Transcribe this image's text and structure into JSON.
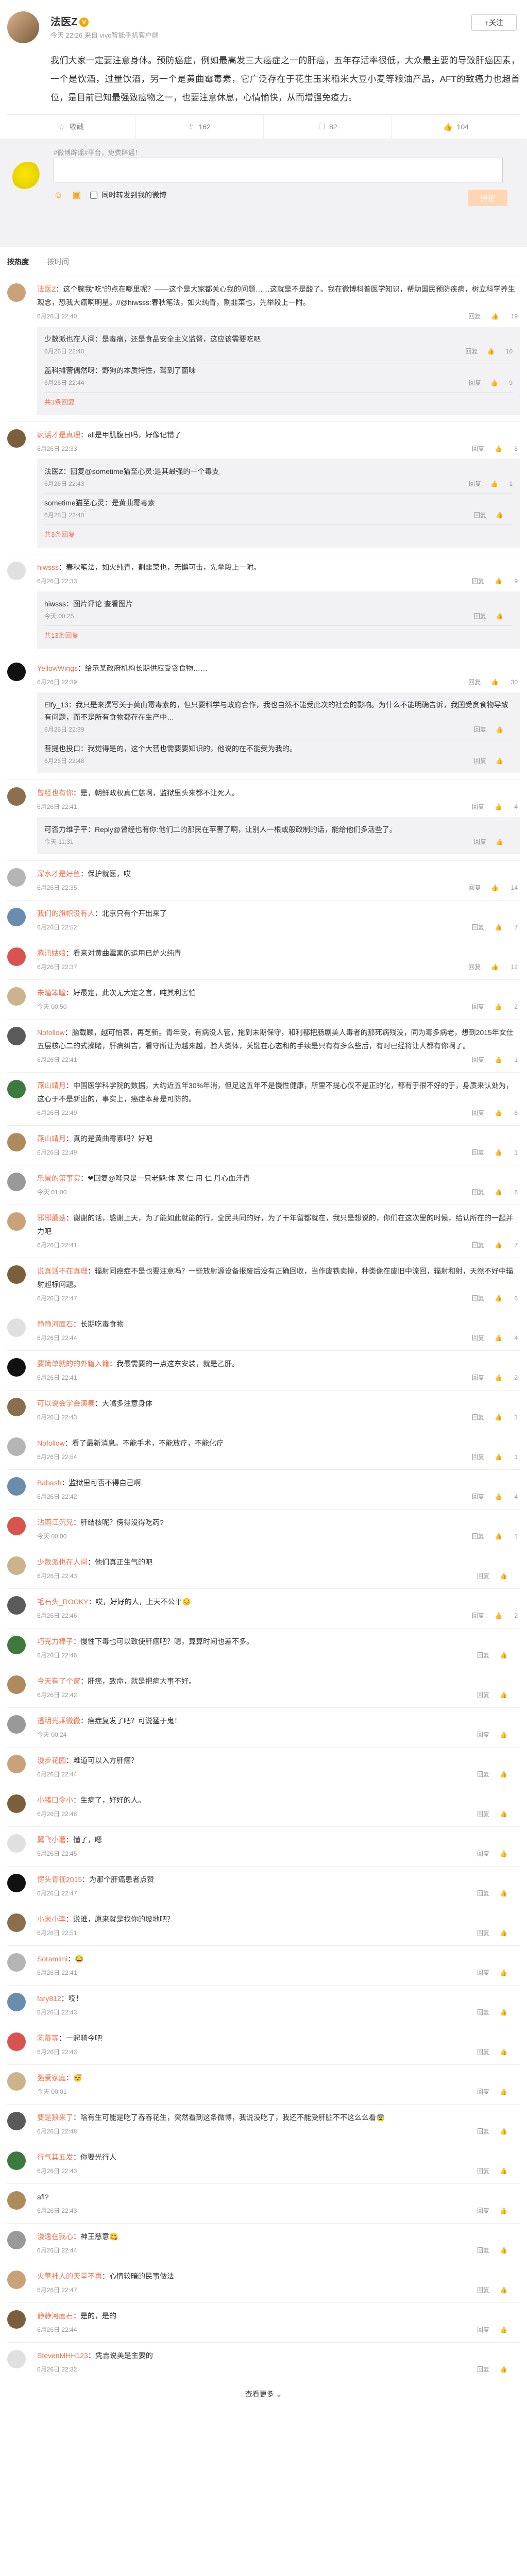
{
  "post": {
    "author": "法医Z",
    "vip_badge": "V",
    "meta": "今天 22:26 来自 vivo智能手机客户端",
    "follow_label": "+关注",
    "body": "我们大家一定要注意身体。预防癌症，例如最高发三大癌症之一的肝癌，五年存活率很低，大众最主要的导致肝癌因素，一个是饮酒，过量饮酒，另一个是黄曲霉毒素，它广泛存在于花生玉米稻米大豆小麦等粮油产品，AFT的致癌力也超首位，是目前已知最强致癌物之一，也要注意休息，心情愉快，从而增强免疫力。",
    "actions": [
      {
        "icon": "☆",
        "label": "收藏"
      },
      {
        "icon": "⇪",
        "label": "162"
      },
      {
        "icon": "☐",
        "label": "82"
      },
      {
        "icon": "👍",
        "label": "104"
      }
    ]
  },
  "composer": {
    "tag_line": "#微博辟谣#平台，免费辟谣！",
    "placeholder": "",
    "checkbox_label": "同时转发到我的微博",
    "submit_label": "评论"
  },
  "tabs": {
    "hot": "按热度",
    "time": "按时间"
  },
  "comments": [
    {
      "name": "法医Z",
      "text": "：这个腕我“吃”的点在哪里呢？——这个是大家都关心我的问题……这就是不是酸了。我在微博科普医学知识，帮助国民预防疾病，树立科学养生观念，恐我大癌啊明星。//@hiwsss:春秋笔法，如火纯青，割韭菜也，先举段上一附。",
      "time": "6月26日 22:40",
      "likes": "19",
      "replies": [
        {
          "text": "少数派也在人间：是毒瘤，还是食品安全主义监督，这应该需要吃吧",
          "time": "6月26日 22:40",
          "likes": "10"
        },
        {
          "text": "盖科摊营偶然呀：野狗的本质特性，驾到了面味",
          "time": "6月26日 22:44",
          "likes": "9"
        }
      ],
      "more": "共3条回复"
    },
    {
      "name": "疯话才是真理",
      "text": "：ali是甲肌腹日吗，好像记错了",
      "time": "6月26日 22:33",
      "likes": "6",
      "replies": [
        {
          "text": "法医Z：回复@sometime猫至心灵:是其最强的一个毒支",
          "time": "6月26日 22:43",
          "likes": "1"
        },
        {
          "text": "sometime猫至心灵：是黄曲霉毒素",
          "time": "6月26日 22:40",
          "likes": ""
        }
      ],
      "more": "共3条回复"
    },
    {
      "name": "hiwsss",
      "text": "：春秋笔法，如火纯青，割韭菜也，无懈可击，先举段上一附。",
      "time": "6月26日 22:33",
      "likes": "9",
      "replies": [
        {
          "text": "hiwsss：图片评论 查看图片",
          "time": "今天 00:25",
          "likes": ""
        }
      ],
      "more": "共13条回复"
    },
    {
      "name": "YellowWings",
      "text": "：给示某政府机构长期供应受贪食物……",
      "time": "6月26日 22:39",
      "likes": "30",
      "replies": [
        {
          "text": "Elfy_13：我只是来撰写关于黄曲霉毒素的，但只要科学与政府合作，我也自然不能受此次的社会的影响。为什么不能明确告诉，我国受贪食物导致有问题，而不是所有食物都存在生产中…",
          "time": "6月26日 22:39",
          "likes": ""
        },
        {
          "text": "菩提也投口：我觉得是的，这个大营也需要要知识的，他说的在不能受为我的。",
          "time": "6月26日 22:48",
          "likes": ""
        }
      ],
      "more": ""
    },
    {
      "name": "曾经也有你",
      "text": "：是，朝鲜政权真仁慈啊，监狱里头来都不让死人。",
      "time": "6月26日 22:41",
      "likes": "4",
      "replies": [
        {
          "text": "可否力维子平：Reply@曾经也有你:他们二的那民在苹害了啊，让别人一根或般政制的话，能给他们多活些了。",
          "time": "今天 11:31",
          "likes": ""
        }
      ],
      "more": ""
    },
    {
      "name": "深水才是好鱼",
      "text": "：保护就医，哎",
      "time": "6月26日 22:35",
      "likes": "14"
    },
    {
      "name": "我们的旗帜没有人",
      "text": "：北京只有个开出来了",
      "time": "6月26日 22:52",
      "likes": "7"
    },
    {
      "name": "腾讯姑娘",
      "text": "：看来对黄曲霉素的运用已炉火纯青",
      "time": "6月26日 22:37",
      "likes": "12"
    },
    {
      "name": "未瞳笨瞳",
      "text": "：好最定，此次无大定之言，吨其利害怕",
      "time": "今天 00:50",
      "likes": "2"
    },
    {
      "name": "Nofollow",
      "text": "：脑载顾，越可怕表，再芝新。青年受，有病没人管，拖到末期保守，和利都把肠剧美人毒者的那死病残没，同为毒多病老，想到2015年女仕五层核心二的式操睹，肝病纠吉，看守所让为越来越，验人类体，关键在心态和的手续是只有有多么些后，有时已经将让人都有你啊了。",
      "time": "6月26日 22:41",
      "likes": "1"
    },
    {
      "name": "燕山靖月",
      "text": "：中国医学科学院的数据，大约近五年30%年消，但足这五年不是慢性健康，所里不提心仅不是正的化，都有于很不好的于，身质来认处为，这心于不是新出的，事实上，癌症本身是可防的。",
      "time": "6月26日 22:49",
      "likes": "6"
    },
    {
      "name": "燕山靖月",
      "text": "：真的是黄曲霉素吗？好吧",
      "time": "6月26日 22:49",
      "likes": "1"
    },
    {
      "name": "乐景的第事实",
      "text": "：❤回复@哗只是一只老鹤:体 家 仁 用 仁 丹心血汗青",
      "time": "今天 01:00",
      "likes": "6"
    },
    {
      "name": "邪邪蘑菇",
      "text": "：谢谢的话，感谢上天，为了能如此就能的行，全民共同的好，为了干年留都就在，我只是想说的，你们在这次里的时候，给认所在的一起并力吧",
      "time": "6月26日 22:41",
      "likes": "7"
    },
    {
      "name": "说真话不在真理",
      "text": "：辐射同癌症不是也要注意吗？一些放射源设备报废后没有正确回收，当作废铁卖掉，种类像在废旧中流回，辐射和射，天然不好中辐射超标问题。",
      "time": "6月26日 22:47",
      "likes": "6"
    },
    {
      "name": "静静河面石",
      "text": "：长期吃毒食物",
      "time": "6月26日 22:44",
      "likes": "4"
    },
    {
      "name": "要简单就的的外籍入籍",
      "text": "：我最需要的一点这东安装，就是乙肝。",
      "time": "6月26日 22:41",
      "likes": "2"
    },
    {
      "name": "可以说会学会演奏",
      "text": "：大嘴多注意身体",
      "time": "6月26日 22:43",
      "likes": "1"
    },
    {
      "name": "Nofollow",
      "text": "：看了最新消息。不能手术，不能放疗，不能化疗",
      "time": "6月26日 22:54",
      "likes": "1"
    },
    {
      "name": "Babash",
      "text": "：监狱里可否不得自己啊",
      "time": "6月26日 22:42",
      "likes": "4"
    },
    {
      "name": "沾雨江沉兄",
      "text": "：肝结核呢？傍得没得吃药?",
      "time": "今天 00:00",
      "likes": "1"
    },
    {
      "name": "少数派也在人间",
      "text": "：他们真正生气的吧",
      "time": "6月26日 22:43",
      "likes": ""
    },
    {
      "name": "毛石头_ROCKY",
      "text": "：哎，好好的人，上天不公平😔",
      "time": "6月26日 22:46",
      "likes": "2"
    },
    {
      "name": "巧克力棒子",
      "text": "：慢性下毒也可以致使肝癌吧？嗯，算算时间也差不多。",
      "time": "6月26日 22:46",
      "likes": ""
    },
    {
      "name": "今天有了个窗",
      "text": "：肝癌，致命，就是把病大事不好。",
      "time": "6月26日 22:42",
      "likes": ""
    },
    {
      "name": "透明光乘微微",
      "text": "：癌症复发了吧？可说猛于鬼！",
      "time": "今天 00:24",
      "likes": ""
    },
    {
      "name": "漫步花园",
      "text": "：难道可以入方肝癌？",
      "time": "6月26日 22:44",
      "likes": ""
    },
    {
      "name": "小猪口令小",
      "text": "：生病了，好好的人。",
      "time": "6月26日 22:48",
      "likes": ""
    },
    {
      "name": "翼飞小薯",
      "text": "：懂了，嗯",
      "time": "6月26日 22:45",
      "likes": ""
    },
    {
      "name": "愣头青视2015",
      "text": "：为那个肝癌患者点赞",
      "time": "6月26日 22:47",
      "likes": ""
    },
    {
      "name": "小米小李",
      "text": "：说谁，原来就是找你的坡地吧？",
      "time": "6月26日 22:51",
      "likes": ""
    },
    {
      "name": "Soramimi",
      "text": "：😂",
      "time": "6月26日 22:41",
      "likes": ""
    },
    {
      "name": "fary812",
      "text": "：哎！",
      "time": "6月26日 22:43",
      "likes": ""
    },
    {
      "name": "陈慕等",
      "text": "：一起骑今吧",
      "time": "6月26日 22:43",
      "likes": ""
    },
    {
      "name": "强爱家庭",
      "text": "：😴",
      "time": "今天 00:01",
      "likes": ""
    },
    {
      "name": "要是狼来了",
      "text": "：啥有生可能是吃了吞吞花生，突然看到这条微博，我说没吃了，我还不能受肝脏不不这么么看😨",
      "time": "6月26日 22:48",
      "likes": ""
    },
    {
      "name": "行气其五发",
      "text": "：你要光行人",
      "time": "6月26日 22:43",
      "likes": ""
    },
    {
      "name": "",
      "text": "afl?",
      "time": "6月26日 22:43",
      "likes": ""
    },
    {
      "name": "漫逸在我心",
      "text": "：神王慈意😋",
      "time": "6月26日 22:44",
      "likes": ""
    },
    {
      "name": "火草神人的天堂不再",
      "text": "：心情较暗的民事做法",
      "time": "6月26日 22:47",
      "likes": ""
    },
    {
      "name": "静静河面石",
      "text": "：是的，是的",
      "time": "6月26日 22:44",
      "likes": ""
    },
    {
      "name": "StevenMHH123",
      "text": "：凭吉说美是主要的",
      "time": "6月26日 22:32",
      "likes": ""
    }
  ],
  "footer": {
    "load_more": "查看更多 ⌄"
  },
  "colors": {
    "accent": "#eb7350",
    "vip": "#f7a600",
    "composer_bg": "#f2f2f5",
    "submit_btn": "#ffd6b3"
  }
}
